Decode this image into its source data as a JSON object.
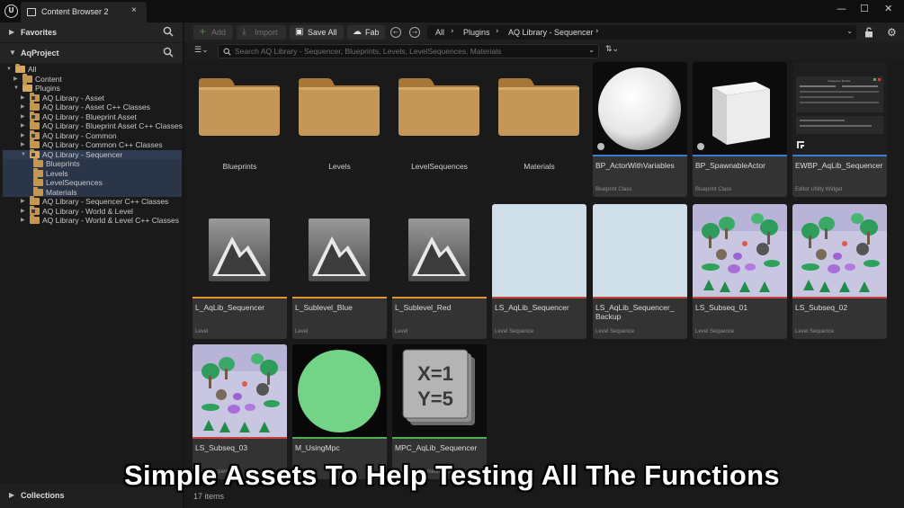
{
  "window": {
    "logo_text": "U",
    "tab_title": "Content Browser 2",
    "tab_close": "×",
    "controls": {
      "minimize": "—",
      "maximize": "☐",
      "close": "✕"
    }
  },
  "left_panel": {
    "favorites_label": "Favorites",
    "project_label": "AqProject",
    "collections_label": "Collections",
    "tree": [
      {
        "label": "All",
        "depth": 0,
        "expanded": true,
        "selected": false
      },
      {
        "label": "Content",
        "depth": 1,
        "expanded": false,
        "selected": false
      },
      {
        "label": "Plugins",
        "depth": 1,
        "expanded": true,
        "selected": false
      },
      {
        "label": "AQ Library - Asset",
        "depth": 2,
        "expanded": false,
        "plugin": true
      },
      {
        "label": "AQ Library - Asset C++ Classes",
        "depth": 2,
        "expanded": false,
        "plugin": false
      },
      {
        "label": "AQ Library - Blueprint Asset",
        "depth": 2,
        "expanded": false,
        "plugin": true
      },
      {
        "label": "AQ Library - Blueprint Asset C++ Classes",
        "depth": 2,
        "expanded": false,
        "plugin": false
      },
      {
        "label": "AQ Library - Common",
        "depth": 2,
        "expanded": false,
        "plugin": true
      },
      {
        "label": "AQ Library - Common C++ Classes",
        "depth": 2,
        "expanded": false,
        "plugin": false
      },
      {
        "label": "AQ Library - Sequencer",
        "depth": 2,
        "expanded": true,
        "selected": true,
        "plugin": true
      },
      {
        "label": "Blueprints",
        "depth": 3,
        "child_selected": true
      },
      {
        "label": "Levels",
        "depth": 3,
        "child_selected": true
      },
      {
        "label": "LevelSequences",
        "depth": 3,
        "child_selected": true
      },
      {
        "label": "Materials",
        "depth": 3,
        "child_selected": true
      },
      {
        "label": "AQ Library - Sequencer C++ Classes",
        "depth": 2,
        "expanded": false,
        "plugin": false
      },
      {
        "label": "AQ Library - World & Level",
        "depth": 2,
        "expanded": false,
        "plugin": true
      },
      {
        "label": "AQ Library - World & Level C++ Classes",
        "depth": 2,
        "expanded": false,
        "plugin": false
      }
    ]
  },
  "toolbar": {
    "add_label": "Add",
    "import_label": "Import",
    "save_all_label": "Save All",
    "fab_label": "Fab",
    "breadcrumb": [
      "All",
      "Plugins",
      "AQ Library - Sequencer"
    ]
  },
  "filter": {
    "search_placeholder": "Search AQ Library - Sequencer, Blueprints, Levels, LevelSequences, Materials"
  },
  "assets": [
    {
      "name": "Blueprints",
      "kind": "folder"
    },
    {
      "name": "Levels",
      "kind": "folder"
    },
    {
      "name": "LevelSequences",
      "kind": "folder"
    },
    {
      "name": "Materials",
      "kind": "folder"
    },
    {
      "name": "BP_ActorWithVariables",
      "kind": "asset",
      "type": "Blueprint Class",
      "thumb": "sphere",
      "bar_color": "#3a7bd5"
    },
    {
      "name": "BP_SpawnableActor",
      "kind": "asset",
      "type": "Blueprint Class",
      "thumb": "cube",
      "bar_color": "#3a7bd5"
    },
    {
      "name": "EWBP_AqLib_Sequencer",
      "kind": "asset",
      "type": "Editor Utility Widget",
      "thumb": "widget",
      "bar_color": "#3a7bd5"
    },
    {
      "name": "L_AqLib_Sequencer",
      "kind": "asset",
      "type": "Level",
      "thumb": "level",
      "bar_color": "#e0962a"
    },
    {
      "name": "L_Sublevel_Blue",
      "kind": "asset",
      "type": "Level",
      "thumb": "level",
      "bar_color": "#e0962a"
    },
    {
      "name": "L_Sublevel_Red",
      "kind": "asset",
      "type": "Level",
      "thumb": "level",
      "bar_color": "#e0962a"
    },
    {
      "name": "LS_AqLib_Sequencer",
      "kind": "asset",
      "type": "Level Sequence",
      "thumb": "blank",
      "bar_color": "#c7413e"
    },
    {
      "name": "LS_AqLib_Sequencer_ Backup",
      "kind": "asset",
      "type": "Level Sequence",
      "thumb": "blank",
      "bar_color": "#c7413e"
    },
    {
      "name": "LS_Subseq_01",
      "kind": "asset",
      "type": "Level Sequence",
      "thumb": "scene",
      "bar_color": "#c7413e"
    },
    {
      "name": "LS_Subseq_02",
      "kind": "asset",
      "type": "Level Sequence",
      "thumb": "scene",
      "bar_color": "#c7413e"
    },
    {
      "name": "LS_Subseq_03",
      "kind": "asset",
      "type": "Level Sequence",
      "thumb": "scene",
      "bar_color": "#c7413e"
    },
    {
      "name": "M_UsingMpc",
      "kind": "asset",
      "type": "Material",
      "thumb": "green-sphere",
      "bar_color": "#4caf50"
    },
    {
      "name": "MPC_AqLib_Sequencer",
      "kind": "asset",
      "type": "Material Parameter Collection",
      "thumb": "mpc",
      "bar_color": "#4caf50",
      "mpc_lines": [
        "X=1",
        "Y=5"
      ]
    }
  ],
  "widget_preview_title": "Sequencer Module",
  "status": {
    "items_label": "17 items"
  },
  "caption": "Simple Assets To Help Testing All The Functions"
}
